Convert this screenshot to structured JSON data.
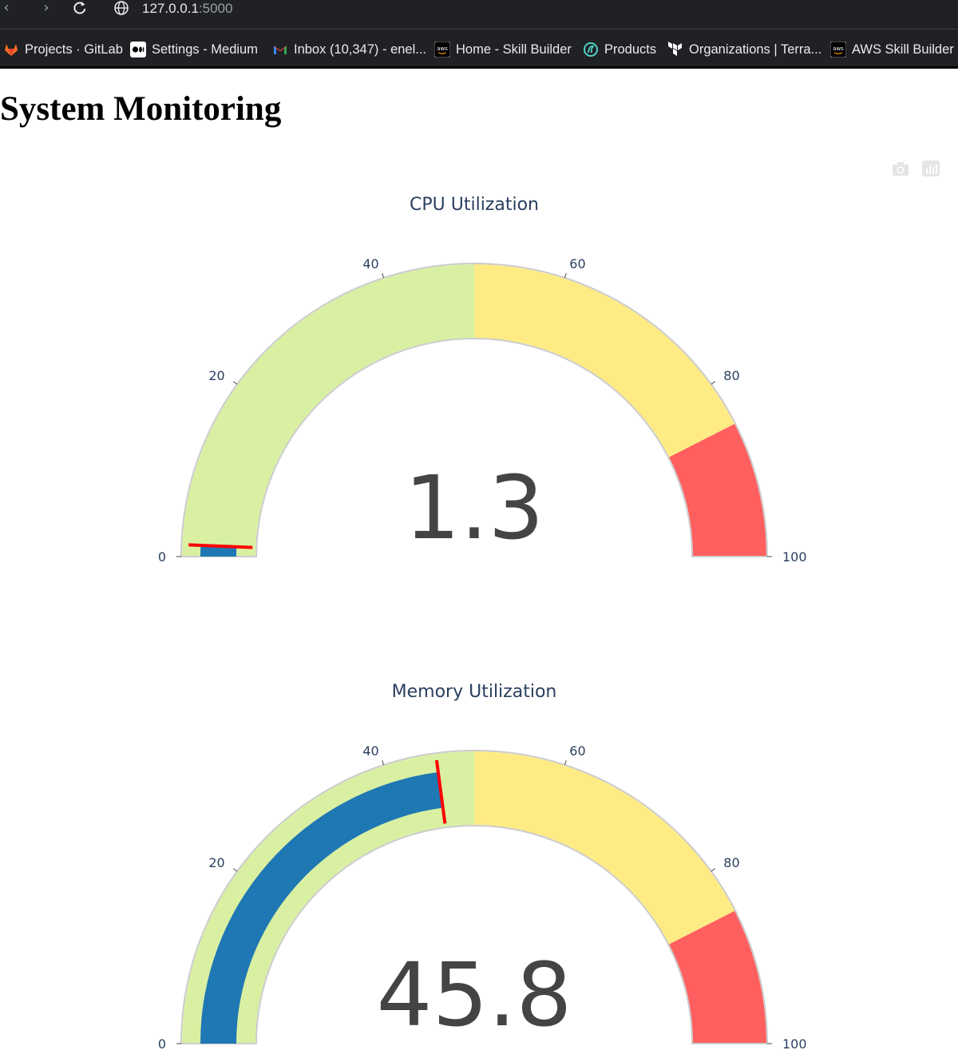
{
  "browser": {
    "url_host": "127.0.0.1",
    "url_port": ":5000",
    "bookmarks": [
      {
        "label": "Projects · GitLab",
        "icon": "gitlab-icon"
      },
      {
        "label": "Settings - Medium",
        "icon": "medium-icon"
      },
      {
        "label": "Inbox (10,347) - enel...",
        "icon": "gmail-icon"
      },
      {
        "label": "Home - Skill Builder",
        "icon": "aws-icon"
      },
      {
        "label": "Products",
        "icon": "products-icon"
      },
      {
        "label": "Organizations | Terra...",
        "icon": "terraform-icon"
      },
      {
        "label": "AWS Skill Builder",
        "icon": "aws-icon"
      }
    ]
  },
  "page": {
    "title": "System Monitoring"
  },
  "colors": {
    "band_low": "#d9f0a3",
    "band_mid": "#ffeb84",
    "band_high": "#ff5f5f",
    "bar": "#1f77b4",
    "threshold": "#ff0000",
    "border": "#cccccc"
  },
  "chart_data": [
    {
      "type": "gauge",
      "title": "CPU Utilization",
      "value": 1.3,
      "value_text": "1.3",
      "range": [
        0,
        100
      ],
      "ticks": [
        "0",
        "20",
        "40",
        "60",
        "80",
        "100"
      ],
      "steps": [
        {
          "range": [
            0,
            50
          ],
          "color": "#d9f0a3"
        },
        {
          "range": [
            50,
            85
          ],
          "color": "#ffeb84"
        },
        {
          "range": [
            85,
            100
          ],
          "color": "#ff5f5f"
        }
      ],
      "threshold": 1.3
    },
    {
      "type": "gauge",
      "title": "Memory Utilization",
      "value": 45.8,
      "value_text": "45.8",
      "range": [
        0,
        100
      ],
      "ticks": [
        "0",
        "20",
        "40",
        "60",
        "80",
        "100"
      ],
      "steps": [
        {
          "range": [
            0,
            50
          ],
          "color": "#d9f0a3"
        },
        {
          "range": [
            50,
            85
          ],
          "color": "#ffeb84"
        },
        {
          "range": [
            85,
            100
          ],
          "color": "#ff5f5f"
        }
      ],
      "threshold": 45.8
    }
  ]
}
